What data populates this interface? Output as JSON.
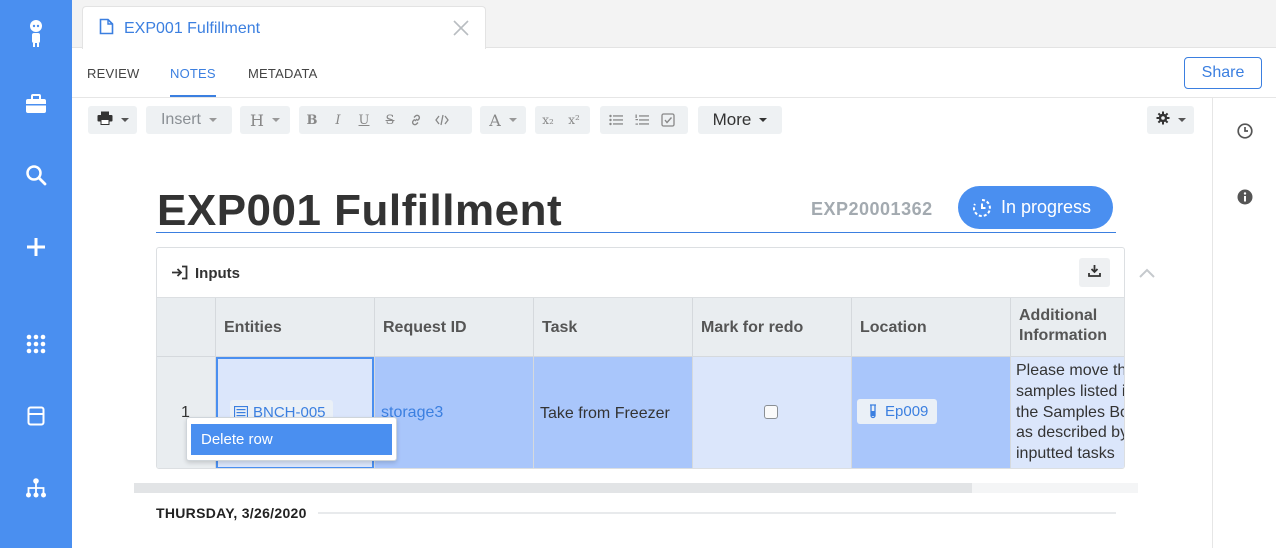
{
  "app": {
    "accent_color": "#4a8ff0",
    "rail_icons": [
      "robot-logo-icon",
      "briefcase-icon",
      "search-icon",
      "plus-icon",
      "grid-icon",
      "panel-icon",
      "hierarchy-icon"
    ]
  },
  "document_tab": {
    "title": "EXP001 Fulfillment",
    "icon": "document-icon",
    "close_icon": "close-icon"
  },
  "subtabs": [
    {
      "label": "REVIEW",
      "active": false
    },
    {
      "label": "NOTES",
      "active": true
    },
    {
      "label": "METADATA",
      "active": false
    }
  ],
  "share_label": "Share",
  "toolbar": {
    "print_icon": "printer-icon",
    "insert_label": "Insert",
    "heading_label": "H",
    "format_buttons": [
      "B",
      "I",
      "U",
      "S"
    ],
    "font_color_label": "A",
    "subscript_label": "x₂",
    "superscript_label": "x²",
    "more_label": "More",
    "settings_icon": "gear-icon"
  },
  "right_panel_icons": [
    "clock-icon",
    "info-icon"
  ],
  "entry": {
    "title": "EXP001 Fulfillment",
    "id": "EXP20001362",
    "status": "In progress"
  },
  "inputs": {
    "title": "Inputs",
    "columns": [
      "",
      "Entities",
      "Request ID",
      "Task",
      "Mark for redo",
      "Location",
      "Additional Information"
    ],
    "rows": [
      {
        "index": "1",
        "entity": "BNCH-005",
        "request_id": "storage3",
        "task": "Take from Freezer",
        "mark_for_redo": false,
        "location": "Ep009",
        "additional_information": "Please move the samples listed in the Samples Box as described by inputted tasks"
      }
    ]
  },
  "context_menu": {
    "items": [
      "Delete row"
    ]
  },
  "date_separator": "THURSDAY, 3/26/2020"
}
